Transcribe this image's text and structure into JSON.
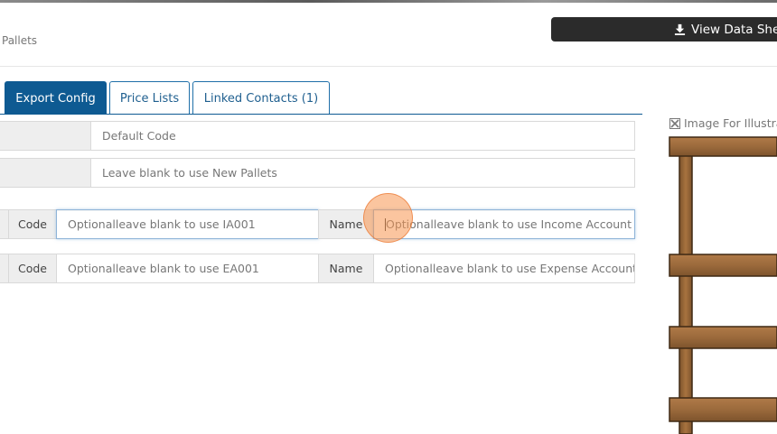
{
  "breadcrumb": "Pallets",
  "view_data_sheet": {
    "label": "View Data Sheet",
    "icon": "download-icon"
  },
  "tabs": [
    {
      "label": "Export Config",
      "active": true
    },
    {
      "label": "Price Lists",
      "active": false
    },
    {
      "label": "Linked Contacts (1)",
      "active": false
    }
  ],
  "form": {
    "default_code": {
      "placeholder": "Default Code"
    },
    "name": {
      "placeholder": "Leave blank to use New Pallets"
    },
    "income": {
      "code_label": "Code",
      "code_placeholder": "Optionalleave blank to use IA001",
      "name_label": "Name",
      "name_placeholder": "Optionalleave blank to use Income Account"
    },
    "expense": {
      "code_label": "Code",
      "code_placeholder": "Optionalleave blank to use EA001",
      "name_label": "Name",
      "name_placeholder": "Optionalleave blank to use Expense Account"
    }
  },
  "image_panel": {
    "label": "Image For Illustrat",
    "icon": "expand-icon"
  },
  "colors": {
    "tab_active": "#0e5a92",
    "button_dark": "#2b2b2b",
    "wood": "#9b6a3c",
    "click_marker": "#f79650"
  }
}
